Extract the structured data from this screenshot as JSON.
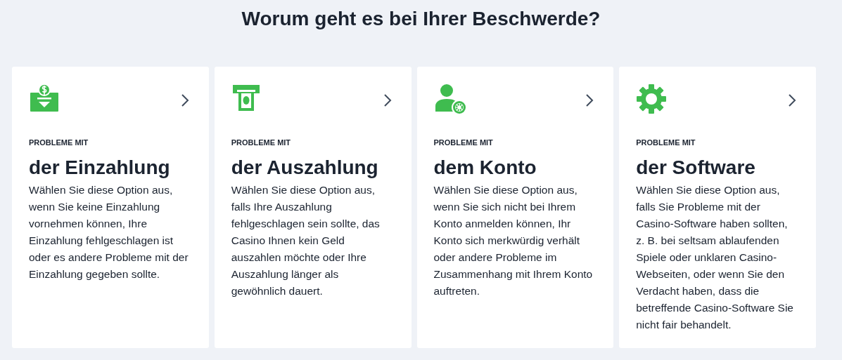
{
  "title": "Worum geht es bei Ihrer Beschwerde?",
  "cards": [
    {
      "kind": "deposit",
      "eyebrow": "PROBLEME MIT",
      "heading": "der Einzahlung",
      "description": "Wählen Sie diese Option aus, wenn Sie keine Einzahlung vornehmen können, Ihre Einzahlung fehlgeschlagen ist oder es andere Probleme mit der Einzahlung gegeben sollte."
    },
    {
      "kind": "withdrawal",
      "eyebrow": "PROBLEME MIT",
      "heading": "der Auszahlung",
      "description": "Wählen Sie diese Option aus, falls Ihre Auszahlung fehlgeschlagen sein sollte, das Casino Ihnen kein Geld auszahlen möchte oder Ihre Auszahlung länger als gewöhnlich dauert."
    },
    {
      "kind": "account",
      "eyebrow": "PROBLEME MIT",
      "heading": "dem Konto",
      "description": "Wählen Sie diese Option aus, wenn Sie sich nicht bei Ihrem Konto anmelden können, Ihr Konto sich merkwürdig verhält oder andere Probleme im Zusammenhang mit Ihrem Konto auftreten."
    },
    {
      "kind": "software",
      "eyebrow": "PROBLEME MIT",
      "heading": "der Software",
      "description": "Wählen Sie diese Option aus, falls Sie Probleme mit der Casino-Software haben sollten, z. B. bei seltsam ablaufenden Spiele oder unklaren Casino-Webseiten, oder wenn Sie den Verdacht haben, dass die betreffende Casino-Software Sie nicht fair behandelt."
    }
  ]
}
